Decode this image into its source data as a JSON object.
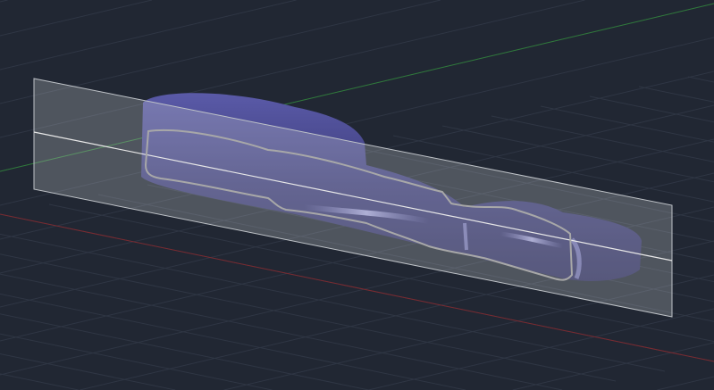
{
  "viewport": {
    "background_color": "#212733",
    "grid_color": "#2f3644",
    "x_axis_color": "#7a2a30",
    "y_axis_color": "#2f7a3a",
    "section_plane_fill": "#c8ccd0",
    "section_line_color": "#e8e8e8",
    "solid_color": "#4a4a8a",
    "section_outline_color": "#a8a8a8"
  }
}
